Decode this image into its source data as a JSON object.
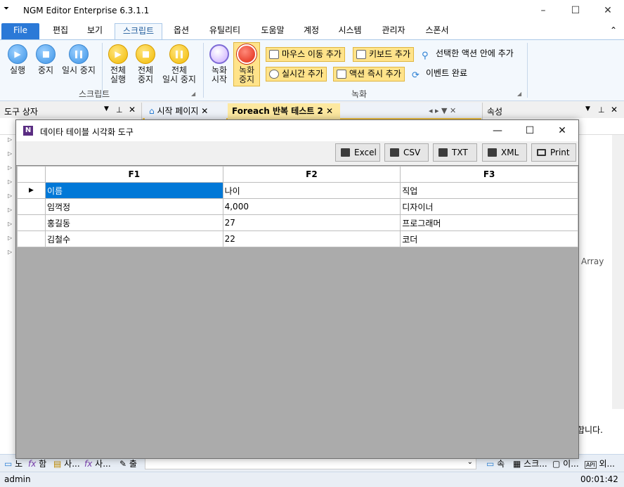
{
  "app": {
    "title": "NGM Editor   Enterprise 6.3.1.1",
    "qa_label": "⏷",
    "minimize": "–",
    "maximize": "☐",
    "close": "✕"
  },
  "ribbon_tabs": [
    "File",
    "편집",
    "보기",
    "스크립트",
    "옵션",
    "유틸리티",
    "도움말",
    "계정",
    "시스템",
    "관리자",
    "스폰서"
  ],
  "ribbon_collapse": "⌃",
  "ribbon": {
    "script_group_label": "스크립트",
    "record_group_label": "녹화",
    "buttons": {
      "run": "실행",
      "stop": "중지",
      "pause": "일시 중지",
      "run_all_1": "전체",
      "run_all_2": "실행",
      "stop_all_1": "전체",
      "stop_all_2": "중지",
      "pause_all_1": "전체",
      "pause_all_2": "일시 중지",
      "rec_start_1": "녹화",
      "rec_start_2": "시작",
      "rec_stop_1": "녹화",
      "rec_stop_2": "중지"
    },
    "small_buttons": {
      "mouse_move": "마우스 이동 추가",
      "keyboard": "키보드 추가",
      "selected_in_action": "선택한 액션 안에 추가",
      "realtime": "실시간 추가",
      "action_now": "액션 즉시 추가",
      "event_done": "이벤트 완료"
    }
  },
  "panels": {
    "left_title": "도구 상자",
    "right_title": "속성",
    "right_array_text": "Array",
    "right_bottom_text": "합니다.",
    "pin": "📌",
    "menu": "▼",
    "close": "✕"
  },
  "doc_tabs": {
    "start_page": "시작 페이지",
    "foreach": "Foreach 반복 테스트 2",
    "close": "✕",
    "nav": "◂ ▸ ▼ ✕"
  },
  "dialog": {
    "title": "데이타 테이블 시각화 도구",
    "icon_letter": "N",
    "minimize": "—",
    "maximize": "☐",
    "close": "✕",
    "toolbar": [
      "Excel",
      "CSV",
      "TXT",
      "XML",
      "Print"
    ],
    "columns": [
      "F1",
      "F2",
      "F3"
    ],
    "rows": [
      [
        "이름",
        "나이",
        "직업"
      ],
      [
        "임꺽정",
        "4,000",
        "디자이너"
      ],
      [
        "홍길동",
        "27",
        "프로그래머"
      ],
      [
        "김철수",
        "22",
        "코더"
      ]
    ],
    "row_indicator": "▶"
  },
  "bottom_tabs": [
    "노",
    "함",
    "사...",
    "사...",
    "출",
    "속",
    "스크...",
    "이...",
    "외..."
  ],
  "status": {
    "user": "admin",
    "timer": "00:01:42"
  }
}
